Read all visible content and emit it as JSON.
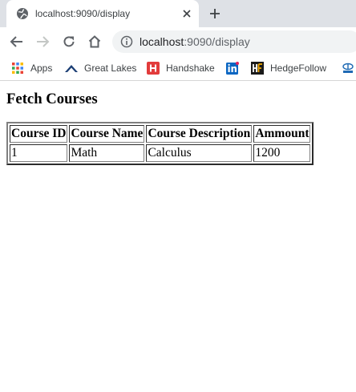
{
  "tab": {
    "title": "localhost:9090/display"
  },
  "address_bar": {
    "host": "localhost",
    "rest": ":9090/display"
  },
  "bookmarks": [
    {
      "label": "Apps",
      "icon": "apps-grid-icon"
    },
    {
      "label": "Great Lakes",
      "icon": "great-lakes-icon"
    },
    {
      "label": "Handshake",
      "icon": "handshake-icon"
    },
    {
      "label": "",
      "icon": "linkedin-icon"
    },
    {
      "label": "HedgeFollow",
      "icon": "hedgefollow-icon"
    },
    {
      "label": "",
      "icon": "tata-icon"
    }
  ],
  "page": {
    "heading": "Fetch Courses",
    "table": {
      "headers": [
        "Course ID",
        "Course Name",
        "Course Description",
        "Ammount"
      ],
      "rows": [
        [
          "1",
          "Math",
          "Calculus",
          "1200"
        ]
      ]
    }
  },
  "colors": {
    "tabstrip": "#dee1e6",
    "omnibox": "#f1f3f4",
    "handshake_red": "#e23b3b",
    "linkedin_blue": "#0a66c2"
  }
}
